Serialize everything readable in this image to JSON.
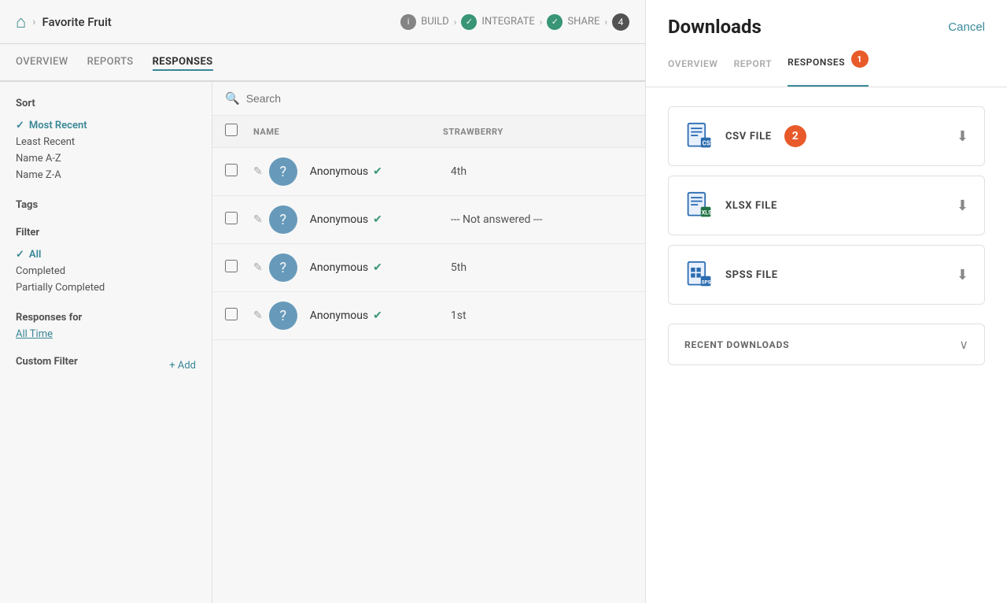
{
  "topNav": {
    "homeIcon": "🏠",
    "breadcrumb": "Favorite Fruit",
    "steps": [
      {
        "label": "BUILD",
        "type": "info",
        "num": "i"
      },
      {
        "label": "INTEGRATE",
        "type": "check"
      },
      {
        "label": "SHARE",
        "type": "check"
      },
      {
        "label": "4",
        "type": "num"
      }
    ]
  },
  "subNav": {
    "tabs": [
      {
        "label": "OVERVIEW",
        "active": false
      },
      {
        "label": "REPORTS",
        "active": false
      },
      {
        "label": "RESPONSES",
        "active": true
      }
    ]
  },
  "sidebar": {
    "sortTitle": "Sort",
    "sortOptions": [
      {
        "label": "Most Recent",
        "active": true
      },
      {
        "label": "Least Recent",
        "active": false
      },
      {
        "label": "Name A-Z",
        "active": false
      },
      {
        "label": "Name Z-A",
        "active": false
      }
    ],
    "tagsTitle": "Tags",
    "filterTitle": "Filter",
    "filterOptions": [
      {
        "label": "All",
        "active": true
      },
      {
        "label": "Completed",
        "active": false
      },
      {
        "label": "Partially Completed",
        "active": false
      }
    ],
    "responsesForTitle": "Responses for",
    "responsesForLink": "All Time",
    "customFilterTitle": "Custom Filter",
    "addLabel": "+ Add"
  },
  "table": {
    "searchPlaceholder": "Search",
    "columns": [
      {
        "label": "NAME"
      },
      {
        "label": "STRAWBERRY"
      }
    ],
    "rows": [
      {
        "name": "Anonymous",
        "value": "4th"
      },
      {
        "name": "Anonymous",
        "value": "--- Not answered ---"
      },
      {
        "name": "Anonymous",
        "value": "5th"
      },
      {
        "name": "Anonymous",
        "value": "1st"
      }
    ]
  },
  "downloads": {
    "title": "Downloads",
    "cancelLabel": "Cancel",
    "tabs": [
      {
        "label": "OVERVIEW",
        "active": false
      },
      {
        "label": "REPORT",
        "active": false
      },
      {
        "label": "RESPONSES",
        "active": true,
        "badge": "1"
      }
    ],
    "files": [
      {
        "label": "CSV FILE",
        "badge": "2",
        "iconType": "csv"
      },
      {
        "label": "XLSX FILE",
        "badge": null,
        "iconType": "xlsx"
      },
      {
        "label": "SPSS FILE",
        "badge": null,
        "iconType": "spss"
      }
    ],
    "recentDownloads": "RECENT DOWNLOADS"
  }
}
